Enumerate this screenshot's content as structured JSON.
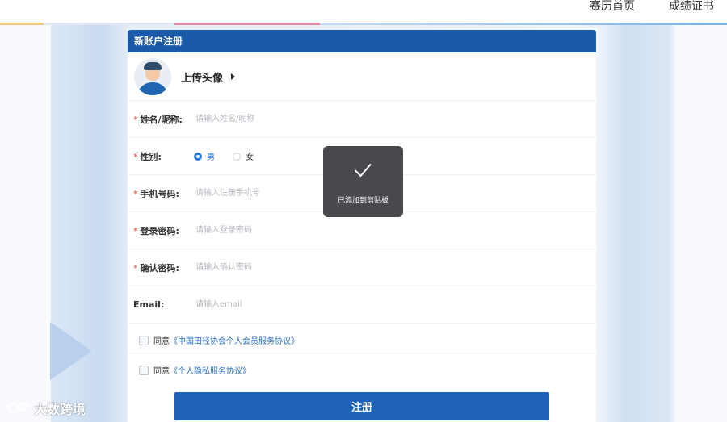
{
  "top_nav": {
    "items": [
      "赛历首页",
      "成绩证书"
    ]
  },
  "card": {
    "title": "新账户注册"
  },
  "avatar": {
    "upload_label": "上传头像"
  },
  "form": {
    "name": {
      "label": "姓名/昵称:",
      "placeholder": "请输入姓名/昵称",
      "required": true
    },
    "gender": {
      "label": "性别:",
      "options": [
        "男",
        "女"
      ],
      "selected": "男",
      "required": true
    },
    "phone": {
      "label": "手机号码:",
      "placeholder": "请输入注册手机号",
      "required": true
    },
    "password": {
      "label": "登录密码:",
      "placeholder": "请输入登录密码",
      "required": true
    },
    "confirm": {
      "label": "确认密码:",
      "placeholder": "请输入确认密码",
      "required": true
    },
    "email": {
      "label": "Email:",
      "placeholder": "请输入email",
      "required": false
    },
    "required_mark": "*"
  },
  "agreements": [
    {
      "prefix": "同意",
      "link": "《中国田径协会个人会员服务协议》",
      "checked": false
    },
    {
      "prefix": "同意",
      "link": "《个人隐私服务协议》",
      "checked": false
    }
  ],
  "submit_label": "注册",
  "toast": {
    "message": "已添加到剪贴板",
    "icon": "check-icon"
  },
  "watermark": {
    "text": "大数跨境"
  },
  "colors": {
    "header_blue": "#1b5aa8",
    "accent_blue": "#2a7ad6",
    "required_red": "#e04848"
  }
}
